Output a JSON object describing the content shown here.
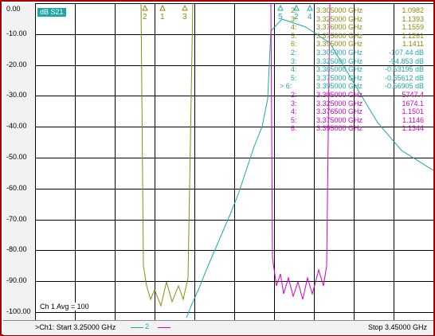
{
  "colors": {
    "trace_s21": "#8a8a10",
    "trace_cyan": "#1fa7a7",
    "trace_magenta": "#d000c0",
    "grid": "#000000",
    "window_border": "#a00000"
  },
  "trace_label": "dB S21",
  "y_ticks": [
    "0.00",
    "-10.00",
    "-20.00",
    "-30.00",
    "-40.00",
    "-50.00",
    "-60.00",
    "-70.00",
    "-80.00",
    "-90.00",
    "-100.00"
  ],
  "markers_top": [
    {
      "label": "2",
      "color": "#8a8a10"
    },
    {
      "label": "1",
      "color": "#8a8a10"
    },
    {
      "label": "3",
      "color": "#8a8a10"
    },
    {
      "label": "5",
      "color": "#1fa7a7"
    },
    {
      "label": "2",
      "color": "#1fa7a7"
    },
    {
      "label": "4",
      "color": "#1fa7a7"
    }
  ],
  "marker_table": [
    {
      "idx": "2:",
      "freq": "3.305000 GHz",
      "value": "1.0982",
      "color": "#8a8a10"
    },
    {
      "idx": "3:",
      "freq": "3.325000 GHz",
      "value": "1.1393",
      "color": "#8a8a10"
    },
    {
      "idx": "4:",
      "freq": "3.376000 GHz",
      "value": "1.1559",
      "color": "#8a8a10"
    },
    {
      "idx": "5:",
      "freq": "3.375000 GHz",
      "value": "1.1261",
      "color": "#8a8a10"
    },
    {
      "idx": "6:",
      "freq": "3.395000 GHz",
      "value": "1.1411",
      "color": "#8a8a10"
    },
    {
      "idx": "2:",
      "freq": "3.305000 GHz",
      "value": "-107.44 dB",
      "color": "#1fa7a7"
    },
    {
      "idx": "3:",
      "freq": "3.325000 GHz",
      "value": "-94.853 dB",
      "color": "#1fa7a7"
    },
    {
      "idx": "4:",
      "freq": "3.385000 GHz",
      "value": "-0.53195 dB",
      "color": "#1fa7a7"
    },
    {
      "idx": "5:",
      "freq": "3.375000 GHz",
      "value": "-0.65612 dB",
      "color": "#1fa7a7"
    },
    {
      "idx": "> 6:",
      "freq": "3.395000 GHz",
      "value": "-0.56905 dB",
      "color": "#1fa7a7"
    },
    {
      "idx": "2:",
      "freq": "3.305000 GHz",
      "value": "5747.4",
      "color": "#d000c0"
    },
    {
      "idx": "3:",
      "freq": "3.325000 GHz",
      "value": "1674.1",
      "color": "#d000c0"
    },
    {
      "idx": "4:",
      "freq": "3.376500 GHz",
      "value": "1.1501",
      "color": "#d000c0"
    },
    {
      "idx": "5:",
      "freq": "3.375000 GHz",
      "value": "1.1146",
      "color": "#d000c0"
    },
    {
      "idx": "6:",
      "freq": "3.395000 GHz",
      "value": "1.1344",
      "color": "#d000c0"
    }
  ],
  "avg_text": "Ch 1 Avg =   100",
  "start_text": ">Ch1: Start  3.25000 GHz",
  "stop_text": "Stop  3.45000 GHz",
  "footer_marker": "2"
}
